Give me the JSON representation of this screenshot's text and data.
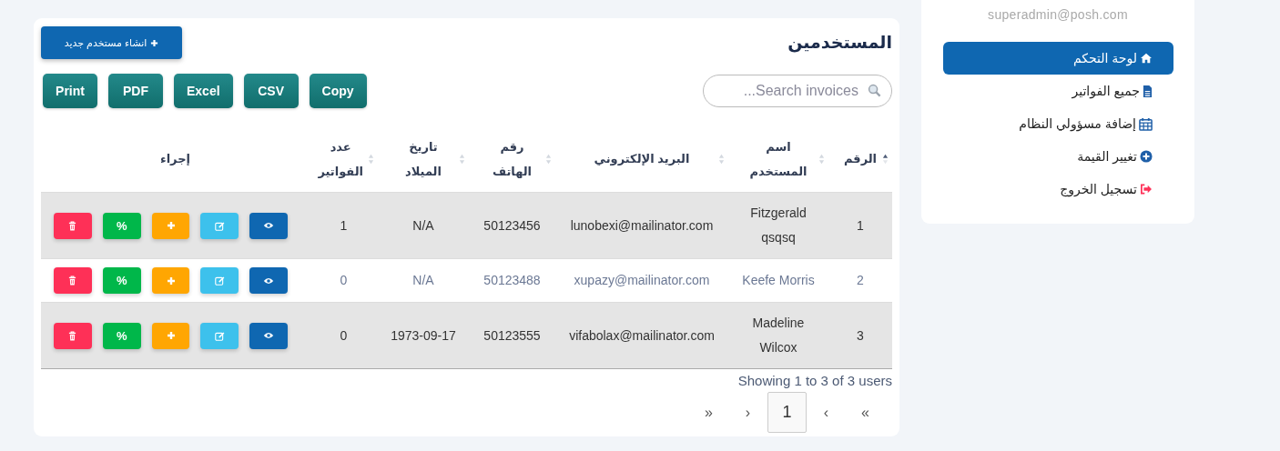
{
  "sidebar": {
    "email": "superadmin@posh.com",
    "items": [
      {
        "label": "لوحة التحكم",
        "selected": true
      },
      {
        "label": "جميع الفواتير",
        "selected": false
      },
      {
        "label": "إضافة مسؤولي النظام",
        "selected": false
      },
      {
        "label": "تغيير القيمة",
        "selected": false
      },
      {
        "label": "تسجيل الخروج",
        "selected": false
      }
    ]
  },
  "panel": {
    "title": "المستخدمين",
    "create_button": "انشاء مستخدم جديد",
    "search": {
      "placeholder": "Search invoices..."
    },
    "export_buttons": [
      "Copy",
      "CSV",
      "Excel",
      "PDF",
      "Print"
    ],
    "table": {
      "columns": [
        {
          "label": "الرقم",
          "sortable": true,
          "sorted": true
        },
        {
          "label": "اسم المستخدم",
          "sortable": true,
          "sorted": false
        },
        {
          "label": "البريد الإلكتروني",
          "sortable": true,
          "sorted": false
        },
        {
          "label": "رقم الهاتف",
          "sortable": true,
          "sorted": false
        },
        {
          "label": "تاريخ الميلاد",
          "sortable": true,
          "sorted": false
        },
        {
          "label": "عدد الفواتير",
          "sortable": true,
          "sorted": false
        },
        {
          "label": "إجراء",
          "sortable": false,
          "sorted": false
        }
      ],
      "rows": [
        {
          "highlighted": true,
          "cells": [
            "1",
            "Fitzgerald qsqsq",
            "lunobexi@mailinator.com",
            "50123456",
            "N/A",
            "1"
          ],
          "actions": [
            {
              "kind": "view"
            },
            {
              "kind": "edit"
            },
            {
              "kind": "add"
            },
            {
              "kind": "percent",
              "label": "%"
            },
            {
              "kind": "delete"
            }
          ]
        },
        {
          "highlighted": false,
          "cells": [
            "2",
            "Keefe Morris",
            "xupazy@mailinator.com",
            "50123488",
            "N/A",
            "0"
          ],
          "actions": [
            {
              "kind": "view"
            },
            {
              "kind": "edit"
            },
            {
              "kind": "add"
            },
            {
              "kind": "percent",
              "label": "%"
            },
            {
              "kind": "delete"
            }
          ]
        },
        {
          "highlighted": true,
          "cells": [
            "3",
            "Madeline Wilcox",
            "vifabolax@mailinator.com",
            "50123555",
            "1973-09-17",
            "0"
          ],
          "actions": [
            {
              "kind": "view"
            },
            {
              "kind": "edit"
            },
            {
              "kind": "add"
            },
            {
              "kind": "percent",
              "label": "%"
            },
            {
              "kind": "delete"
            }
          ]
        }
      ]
    },
    "info": "Showing 1 to 3 of 3 users",
    "pagination": [
      {
        "label": "»",
        "selected": false
      },
      {
        "label": "›",
        "selected": false
      },
      {
        "label": "1",
        "selected": true
      },
      {
        "label": "‹",
        "selected": false
      },
      {
        "label": "«",
        "selected": false
      }
    ]
  }
}
